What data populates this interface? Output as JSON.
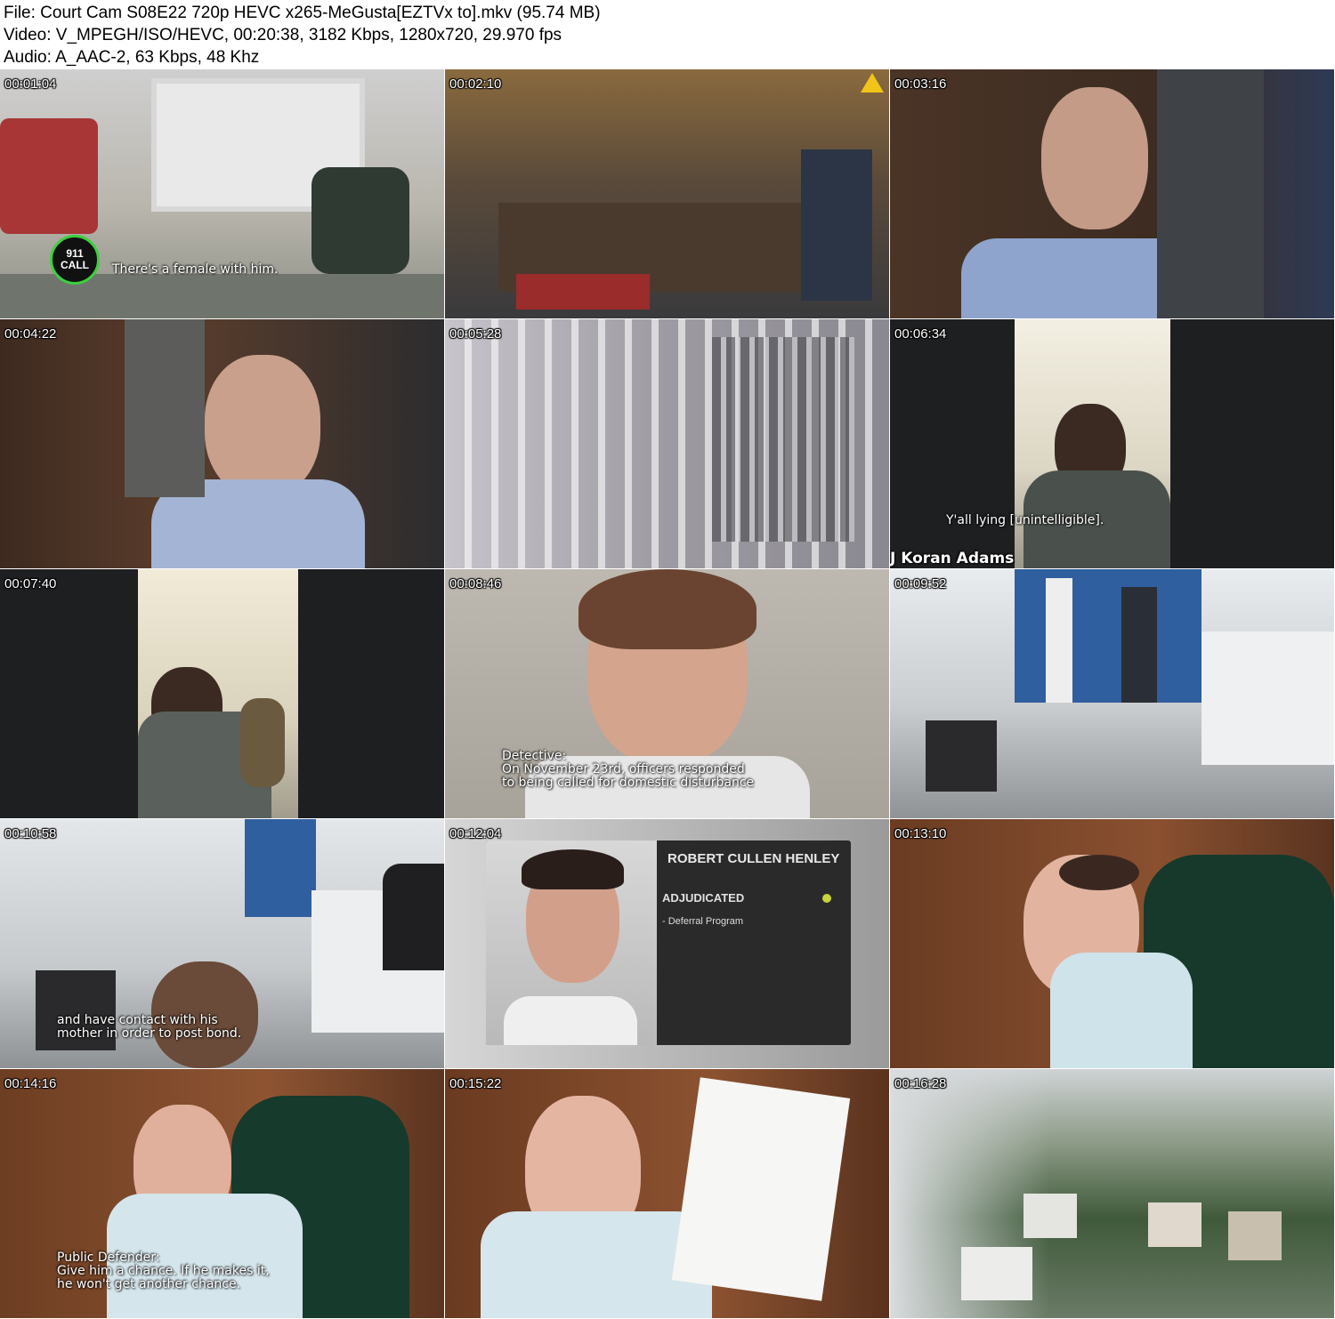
{
  "header": {
    "file_line": "File: Court Cam S08E22 720p HEVC x265-MeGusta[EZTVx to].mkv (95.74 MB)",
    "video_line": "Video: V_MPEGH/ISO/HEVC, 00:20:38, 3182 Kbps, 1280x720, 29.970 fps",
    "audio_line": "Audio: A_AAC-2, 63 Kbps, 48 Khz"
  },
  "thumbnails": [
    {
      "timestamp": "00:01:04",
      "caption": "There's a female with him.",
      "badge_line1": "911",
      "badge_line2": "CALL"
    },
    {
      "timestamp": "00:02:10"
    },
    {
      "timestamp": "00:03:16"
    },
    {
      "timestamp": "00:04:22"
    },
    {
      "timestamp": "00:05:28"
    },
    {
      "timestamp": "00:06:34",
      "caption": "Y'all lying [unintelligible].",
      "name_lower_third": "J Koran Adams"
    },
    {
      "timestamp": "00:07:40"
    },
    {
      "timestamp": "00:08:46",
      "caption_lines": [
        "Detective:",
        "On November 23rd, officers responded",
        "to being called for domestic disturbance"
      ]
    },
    {
      "timestamp": "00:09:52"
    },
    {
      "timestamp": "00:10:58",
      "caption_lines": [
        "and have contact with his",
        "mother in order to post bond."
      ]
    },
    {
      "timestamp": "00:12:04",
      "card": {
        "name": "ROBERT CULLEN HENLEY",
        "status": "ADJUDICATED",
        "item": "- Deferral Program",
        "status_color": "#c9d23a"
      }
    },
    {
      "timestamp": "00:13:10"
    },
    {
      "timestamp": "00:14:16",
      "caption_lines": [
        "Public Defender:",
        "Give him a chance. If he makes it,",
        "he won't get another chance."
      ]
    },
    {
      "timestamp": "00:15:22"
    },
    {
      "timestamp": "00:16:28"
    }
  ]
}
